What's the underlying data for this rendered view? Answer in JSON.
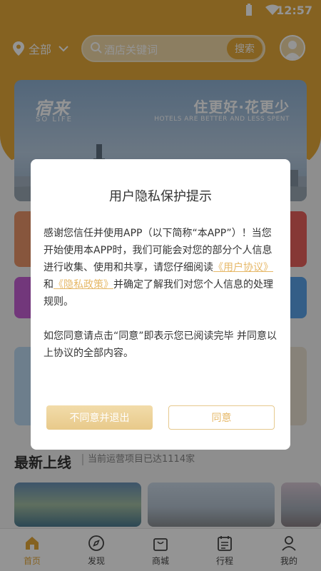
{
  "status_bar": {
    "time": "12:57",
    "wifi_icon": "wifi-icon",
    "battery_icon": "battery-icon"
  },
  "header": {
    "location": "全部",
    "search_placeholder": "酒店关键词",
    "search_button": "搜索",
    "accent_color": "#e6a93a"
  },
  "banner": {
    "brand": "宿来",
    "brand_sub": "SO LIFE",
    "slogan": "住更好·花更少",
    "slogan_sub": "HOTELS ARE BETTER AND LESS SPENT"
  },
  "section": {
    "title": "最新上线",
    "subtitle": "当前运营项目已达1114家"
  },
  "tabbar": {
    "items": [
      {
        "label": "首页",
        "icon": "home-icon"
      },
      {
        "label": "发现",
        "icon": "compass-icon"
      },
      {
        "label": "商城",
        "icon": "shopping-bag-icon"
      },
      {
        "label": "行程",
        "icon": "calendar-icon"
      },
      {
        "label": "我的",
        "icon": "person-icon"
      }
    ]
  },
  "dialog": {
    "title": "用户隐私保护提示",
    "para1_part1": "感谢您信任并使用APP（以下简称“本APP”）！当您开始使用本APP时，我们可能会对您的部分个人信息进行收集、使用和共享，请您仔细阅读",
    "user_agreement_link": "《用户协议》",
    "para1_and": "和",
    "privacy_policy_link": "《隐私政策》",
    "para1_part2": "并确定了解我们对您个人信息的处理规则。",
    "para2": "如您同意请点击“同意”即表示您已阅读完毕 并同意以上协议的全部内容。",
    "decline_button": "不同意并退出",
    "agree_button": "同意"
  }
}
